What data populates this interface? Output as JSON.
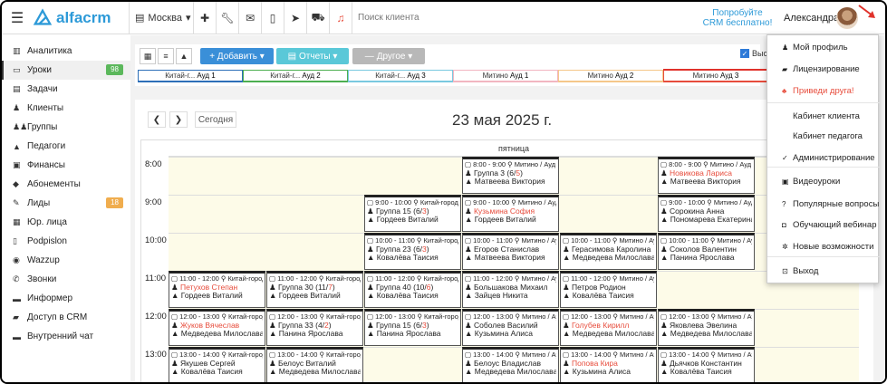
{
  "topbar": {
    "brand": "alfacrm",
    "city": "Москва",
    "search_placeholder": "Поиск клиента",
    "promo_line1": "Попробуйте",
    "promo_line2": "CRM бесплатно!",
    "user_name": "Александра"
  },
  "sidebar": {
    "items": [
      {
        "label": "Аналитика",
        "icon": "chart-icon"
      },
      {
        "label": "Уроки",
        "icon": "lessons-icon",
        "badge": "98"
      },
      {
        "label": "Задачи",
        "icon": "tasks-icon"
      },
      {
        "label": "Клиенты",
        "icon": "user-icon"
      },
      {
        "label": "Группы",
        "icon": "group-icon"
      },
      {
        "label": "Педагоги",
        "icon": "graduation-icon"
      },
      {
        "label": "Финансы",
        "icon": "money-icon"
      },
      {
        "label": "Абонементы",
        "icon": "tag-icon"
      },
      {
        "label": "Лиды",
        "icon": "leads-icon",
        "badge": "18"
      },
      {
        "label": "Юр. лица",
        "icon": "building-icon"
      },
      {
        "label": "Podpislon",
        "icon": "document-icon"
      },
      {
        "label": "Wazzup",
        "icon": "whatsapp-icon"
      },
      {
        "label": "Звонки",
        "icon": "phone-icon"
      },
      {
        "label": "Информер",
        "icon": "informer-icon"
      },
      {
        "label": "Доступ в CRM",
        "icon": "lock-icon"
      },
      {
        "label": "Внутренний чат",
        "icon": "chat-icon"
      }
    ]
  },
  "toolbar": {
    "add_label": "+ Добавить ▾",
    "reports_label": "Отчеты ▾",
    "other_label": "Другое ▾",
    "checkbox_label": "Выст",
    "colors": {
      "add": "#3a8fd8",
      "reports": "#5ac8d8",
      "other": "#b8b8b8"
    }
  },
  "rooms": [
    {
      "place": "Китай-г...",
      "room": "Ауд 1",
      "color": "#2d6fb8"
    },
    {
      "place": "Китай-г...",
      "room": "Ауд 2",
      "color": "#4caf50"
    },
    {
      "place": "Китай-г...",
      "room": "Ауд 3",
      "color": "#7ac9e0"
    },
    {
      "place": "Митино",
      "room": "Ауд 1",
      "color": "#f2b6c1"
    },
    {
      "place": "Митино",
      "room": "Ауд 2",
      "color": "#f5c78a"
    },
    {
      "place": "Митино",
      "room": "Ауд 3",
      "color": "#e74c3c"
    }
  ],
  "calendar": {
    "today_label": "Сегодня",
    "date": "23 мая 2025 г.",
    "day_name": "пятница",
    "hours": [
      "8:00",
      "9:00",
      "10:00",
      "11:00",
      "12:00",
      "13:00"
    ]
  },
  "lessons": [
    {
      "col": 3,
      "hour": 0,
      "time": "8:00 - 9:00",
      "place": "Митино / Ауд 1",
      "name_prefix": "Группа 3 (",
      "n1": "6",
      "n_sep": "/",
      "n2": "5",
      "name_suffix": ")",
      "name_red": false,
      "teacher": "Матвеева Виктория"
    },
    {
      "col": 5,
      "hour": 0,
      "time": "8:00 - 9:00",
      "place": "Митино / Ауд 3",
      "name": "Новикова Лариса",
      "name_red": true,
      "teacher": "Матвеева Виктория"
    },
    {
      "col": 2,
      "hour": 1,
      "time": "9:00 - 10:00",
      "place": "Китай-город /",
      "name_prefix": "Группа 15 (",
      "n1": "6",
      "n_sep": "/",
      "n2": "3",
      "name_suffix": ")",
      "name_red": false,
      "teacher": "Гордеев Виталий"
    },
    {
      "col": 3,
      "hour": 1,
      "time": "9:00 - 10:00",
      "place": "Митино / Ауд 1",
      "name": "Кузьмина София",
      "name_red": true,
      "teacher": "Гордеев Виталий"
    },
    {
      "col": 5,
      "hour": 1,
      "time": "9:00 - 10:00",
      "place": "Митино / Ауд 3",
      "name": "Сорокина Анна",
      "name_red": false,
      "teacher": "Пономарева Екатерина"
    },
    {
      "col": 2,
      "hour": 2,
      "time": "10:00 - 11:00",
      "place": "Китай-город /",
      "name_prefix": "Группа 23 (",
      "n1": "6",
      "n_sep": "/",
      "n2": "3",
      "name_suffix": ")",
      "name_red": false,
      "teacher": "Ковалёва Таисия"
    },
    {
      "col": 3,
      "hour": 2,
      "time": "10:00 - 11:00",
      "place": "Митино / Ауд 1",
      "name": "Егоров Станислав",
      "name_red": false,
      "teacher": "Матвеева Виктория"
    },
    {
      "col": 4,
      "hour": 2,
      "time": "10:00 - 11:00",
      "place": "Митино / Ауд",
      "name": "Герасимова Каролина",
      "name_red": false,
      "teacher": "Медведева Милослава"
    },
    {
      "col": 5,
      "hour": 2,
      "time": "10:00 - 11:00",
      "place": "Митино / Ауд 3",
      "name": "Соколов Валентин",
      "name_red": false,
      "teacher": "Панина Ярослава"
    },
    {
      "col": 0,
      "hour": 3,
      "time": "11:00 - 12:00",
      "place": "Китай-город /",
      "name": "Петухов Степан",
      "name_red": true,
      "teacher": "Гордеев Виталий"
    },
    {
      "col": 1,
      "hour": 3,
      "time": "11:00 - 12:00",
      "place": "Китай-город /",
      "name_prefix": "Группа 30 (",
      "n1": "11",
      "n_sep": "/",
      "n2": "7",
      "name_suffix": ")",
      "name_red": false,
      "teacher": "Гордеев Виталий"
    },
    {
      "col": 2,
      "hour": 3,
      "time": "11:00 - 12:00",
      "place": "Китай-город /",
      "name_prefix": "Группа 40 (",
      "n1": "10",
      "n_sep": "/",
      "n2": "6",
      "name_suffix": ")",
      "name_red": false,
      "teacher": "Ковалёва Таисия"
    },
    {
      "col": 3,
      "hour": 3,
      "time": "11:00 - 12:00",
      "place": "Митино / Ауд 1",
      "name": "Большакова Михаил",
      "name_red": false,
      "teacher": "Зайцев Никита"
    },
    {
      "col": 4,
      "hour": 3,
      "time": "11:00 - 12:00",
      "place": "Митино / Ауд",
      "name": "Петров Родион",
      "name_red": false,
      "teacher": "Ковалёва Таисия"
    },
    {
      "col": 0,
      "hour": 4,
      "time": "12:00 - 13:00",
      "place": "Китай-город /",
      "name": "Жуков Вячеслав",
      "name_red": true,
      "teacher": "Медведева Милослава"
    },
    {
      "col": 1,
      "hour": 4,
      "time": "12:00 - 13:00",
      "place": "Китай-город /",
      "name_prefix": "Группа 33 (",
      "n1": "4",
      "n_sep": "/",
      "n2": "2",
      "name_suffix": ")",
      "name_red": false,
      "teacher": "Панина Ярослава"
    },
    {
      "col": 2,
      "hour": 4,
      "time": "12:00 - 13:00",
      "place": "Китай-город /",
      "name_prefix": "Группа 15 (",
      "n1": "6",
      "n_sep": "/",
      "n2": "3",
      "name_suffix": ")",
      "name_red": false,
      "teacher": "Панина Ярослава"
    },
    {
      "col": 3,
      "hour": 4,
      "time": "12:00 - 13:00",
      "place": "Митино / Ауд 1",
      "name": "Соболев Василий",
      "name_red": false,
      "teacher": "Кузьмина Алиса"
    },
    {
      "col": 4,
      "hour": 4,
      "time": "12:00 - 13:00",
      "place": "Митино / Ауд",
      "name": "Голубев Кирилл",
      "name_red": true,
      "teacher": "Медведева Милослава"
    },
    {
      "col": 5,
      "hour": 4,
      "time": "12:00 - 13:00",
      "place": "Митино / Ауд",
      "name": "Яковлева Эвелина",
      "name_red": false,
      "teacher": "Медведева Милослава"
    },
    {
      "col": 0,
      "hour": 5,
      "time": "13:00 - 14:00",
      "place": "Китай-город /",
      "name": "Якушев Сергей",
      "name_red": false,
      "teacher": "Ковалёва Таисия"
    },
    {
      "col": 1,
      "hour": 5,
      "time": "13:00 - 14:00",
      "place": "Китай-город /",
      "name": "Белоус Виталий",
      "name_red": false,
      "teacher": "Медведева Милослава"
    },
    {
      "col": 3,
      "hour": 5,
      "time": "13:00 - 14:00",
      "place": "Митино / Ауд 1",
      "name": "Белоус Владислав",
      "name_red": false,
      "teacher": "Медведева Милослава"
    },
    {
      "col": 4,
      "hour": 5,
      "time": "13:00 - 14:00",
      "place": "Митино / Ауд",
      "name": "Попова Кира",
      "name_red": true,
      "teacher": "Кузьмина Алиса"
    },
    {
      "col": 5,
      "hour": 5,
      "time": "13:00 - 14:00",
      "place": "Митино / Ауд",
      "name": "Дьячков Константин",
      "name_red": false,
      "teacher": "Ковалёва Таисия"
    }
  ],
  "dropdown": {
    "items": [
      {
        "label": "Мой профиль",
        "icon": "user-icon"
      },
      {
        "label": "Лицензирование",
        "icon": "lock-icon"
      },
      {
        "label": "Приведи друга!",
        "icon": "friends-icon",
        "red": true
      },
      {
        "label": "Кабинет клиента",
        "icon": "none"
      },
      {
        "label": "Кабинет педагога",
        "icon": "none"
      },
      {
        "label": "Администрирование",
        "icon": "check-icon"
      },
      {
        "label": "Видеоуроки",
        "icon": "video-icon"
      },
      {
        "label": "Популярные вопросы",
        "icon": "question-icon"
      },
      {
        "label": "Обучающий вебинар",
        "icon": "webinar-icon"
      },
      {
        "label": "Новые возможности",
        "icon": "sparkle-icon"
      },
      {
        "label": "Выход",
        "icon": "logout-icon"
      }
    ]
  }
}
